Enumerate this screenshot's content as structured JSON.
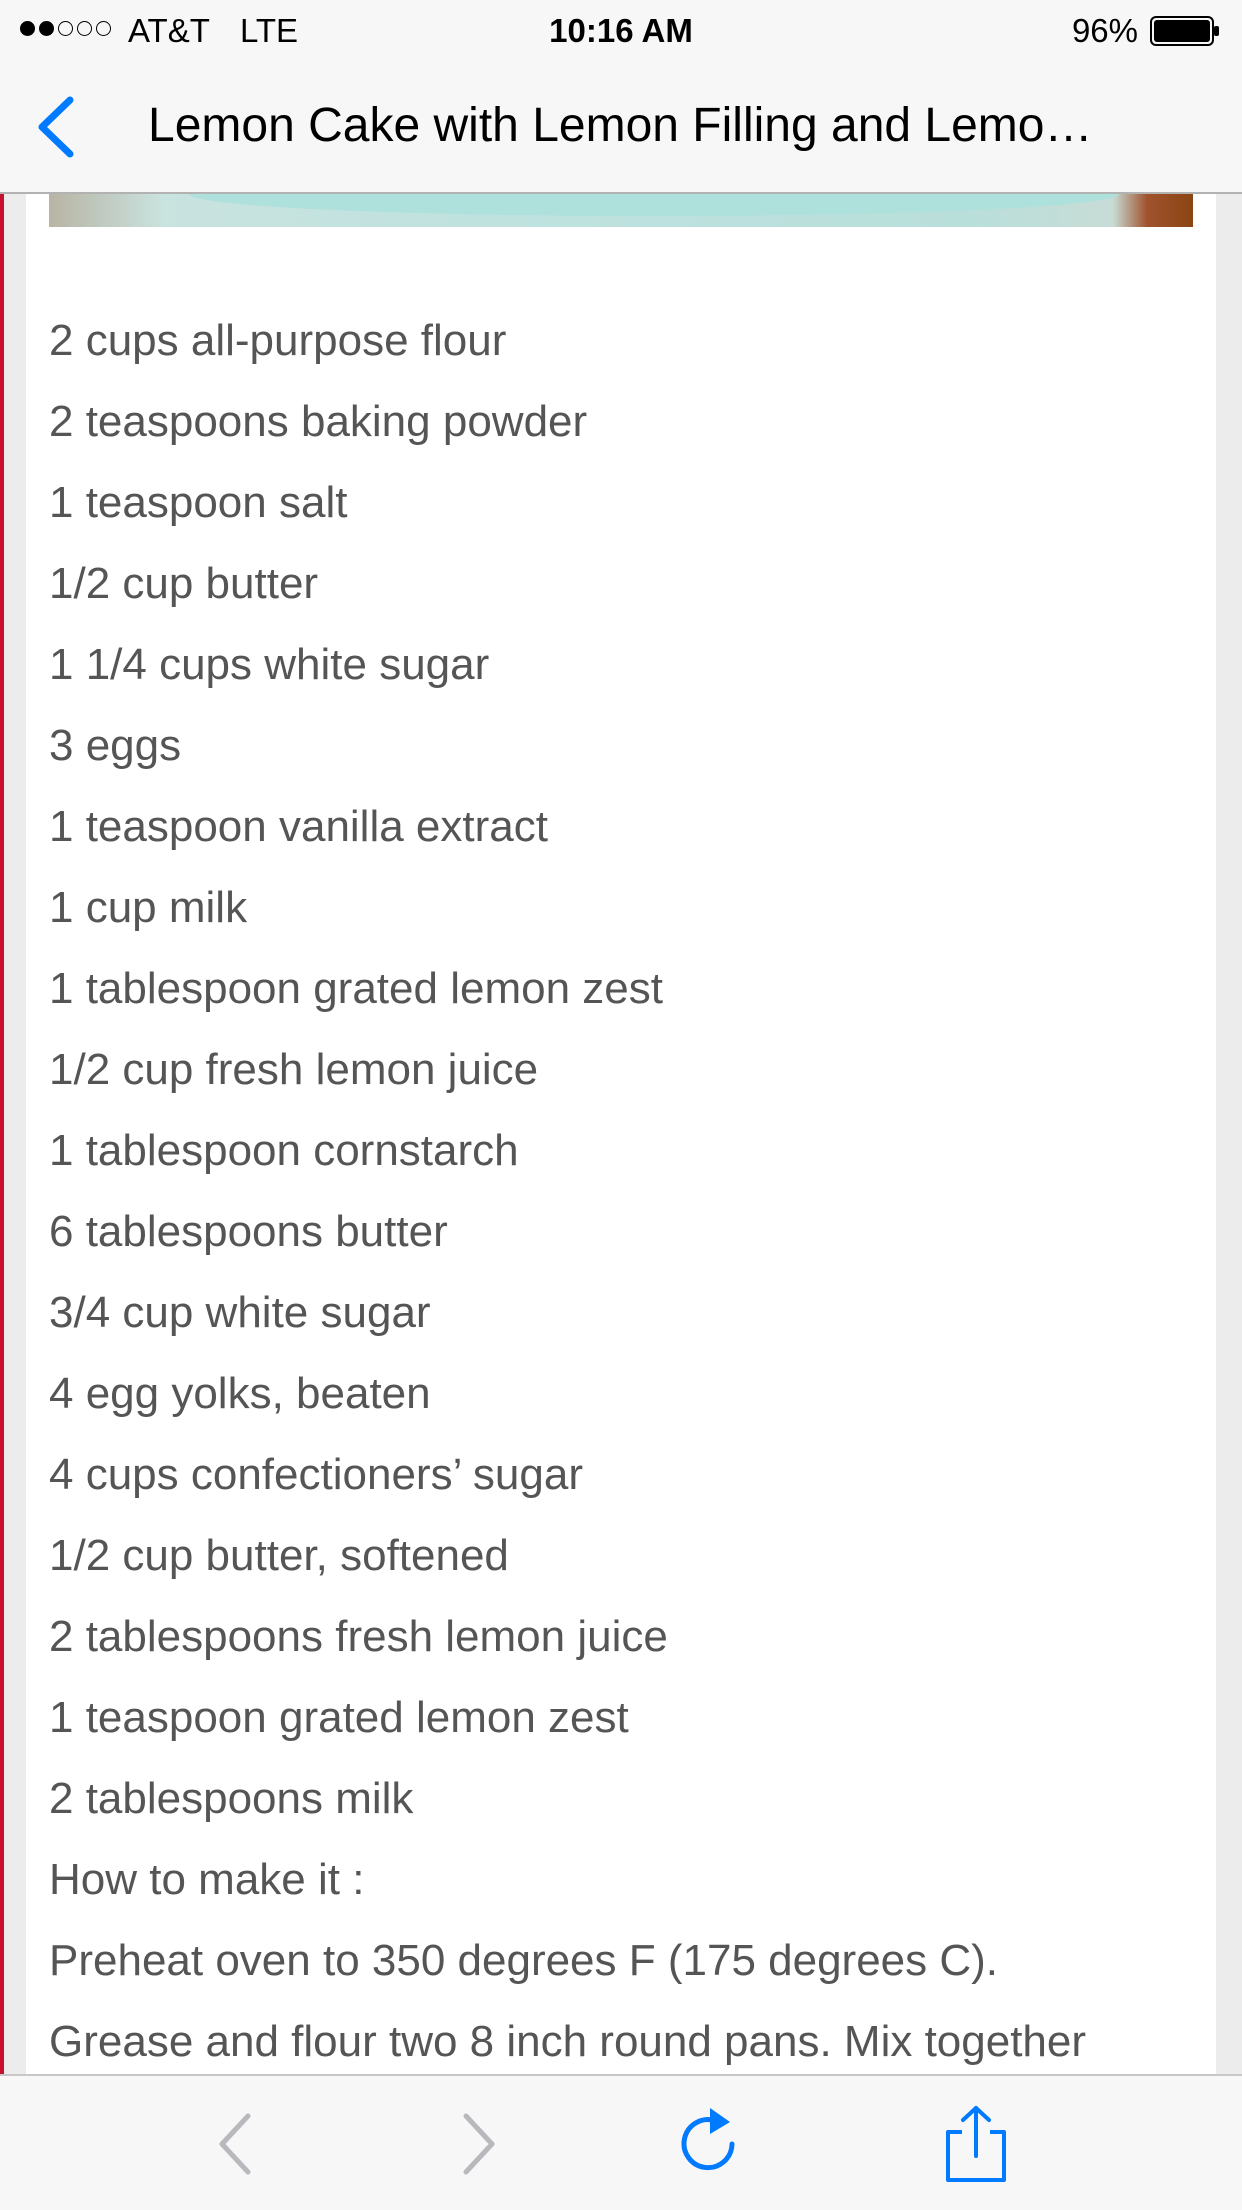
{
  "status_bar": {
    "carrier": "AT&T",
    "network": "LTE",
    "time": "10:16 AM",
    "battery": "96%",
    "signal_bars_filled": 2,
    "signal_bars_total": 5
  },
  "nav": {
    "title": "Lemon Cake with Lemon Filling and Lemo…",
    "back_icon": "chevron-left-icon"
  },
  "content": {
    "lines": [
      "2 cups all-purpose flour",
      "2 teaspoons baking powder",
      "1 teaspoon salt",
      "1/2 cup butter",
      "1 1/4 cups white sugar",
      "3 eggs",
      "1 teaspoon vanilla extract",
      "1 cup milk",
      "1 tablespoon grated lemon zest",
      "1/2 cup fresh lemon juice",
      "1 tablespoon cornstarch",
      "6 tablespoons butter",
      "3/4 cup white sugar",
      "4 egg yolks, beaten",
      "4 cups confectioners’ sugar",
      "1/2 cup butter, softened",
      "2 tablespoons fresh lemon juice",
      "1 teaspoon grated lemon zest",
      "2 tablespoons milk",
      "How to make it :",
      "Preheat oven to 350 degrees F (175 degrees C).",
      "Grease and flour two 8 inch round pans. Mix together"
    ]
  },
  "toolbar": {
    "items": [
      "back-arrow-icon",
      "forward-arrow-icon",
      "reload-icon",
      "share-icon"
    ]
  },
  "colors": {
    "accent": "#007aff",
    "text": "#555555",
    "disabled": "#b9b9bd",
    "bar_background": "#f7f7f7",
    "page_rule": "#c8102e"
  }
}
